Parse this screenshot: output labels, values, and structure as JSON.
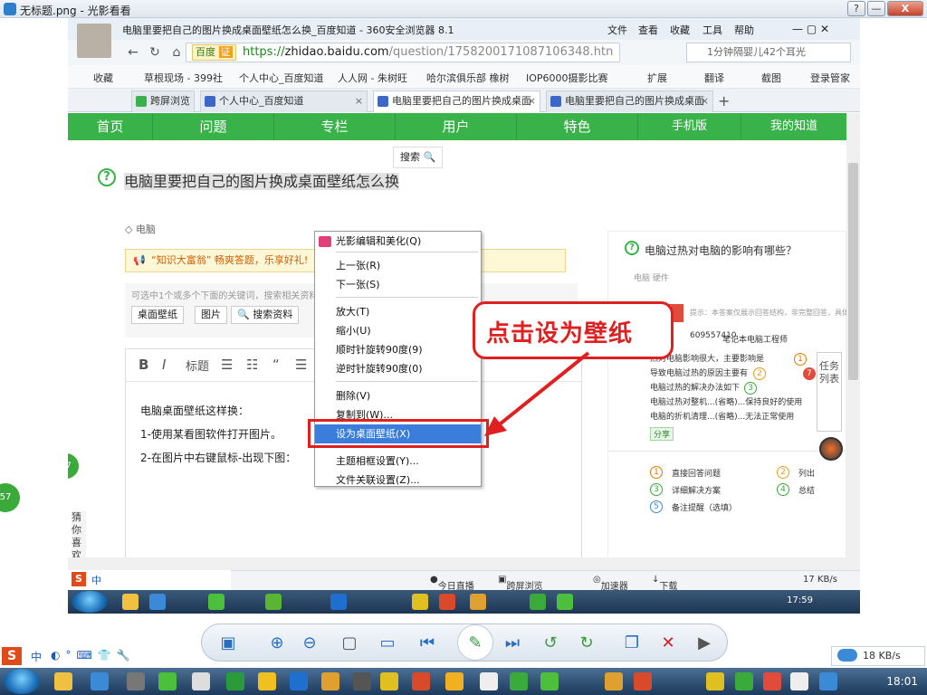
{
  "viewer": {
    "title": "无标题.png - 光影看看",
    "controls": {
      "help": "?",
      "minimize": "—",
      "restore": "□",
      "close": "X"
    },
    "speed": "18 KB/s",
    "clock": "18:01",
    "ime": "中"
  },
  "browser": {
    "title": "电脑里要把自己的图片换成桌面壁纸怎么换_百度知道 - 360安全浏览器 8.1",
    "menu": [
      "文件",
      "查看",
      "收藏",
      "工具",
      "帮助"
    ],
    "baidu_tag": "百度",
    "baidu_tag_cert": "证",
    "url_https": "https://",
    "url_domain": "zhidao.baidu.com",
    "url_rest": "/question/175820017108710634‌8.htn",
    "search_text": "1分钟隔婴儿42个耳光",
    "favorites": [
      "收藏",
      "草根现场 - 399社",
      "个人中心_百度知道",
      "人人网 - 朱树旺",
      "哈尔滨俱乐部 橡树",
      "IOP6000摄影比赛",
      "扩展",
      "翻译",
      "截图",
      "登录管家"
    ],
    "tabs": [
      {
        "label": "跨屏浏览",
        "active": false
      },
      {
        "label": "个人中心_百度知道",
        "active": false
      },
      {
        "label": "电脑里要把自己的图片换成桌面",
        "active": true
      },
      {
        "label": "电脑里要把自己的图片换成桌面",
        "active": false
      }
    ],
    "status": [
      "今日直播",
      "跨屏浏览",
      "加速器",
      "下载",
      "17 KB/s"
    ],
    "inner_clock": "17:59"
  },
  "page": {
    "nav": [
      "首页",
      "问题",
      "专栏",
      "用户",
      "特色",
      "手机版",
      "我的知道"
    ],
    "search_mini": "搜索",
    "question_title": "电脑里要把自己的图片换成桌面壁纸怎么换",
    "tag": "电脑",
    "promo_prefix": "“知识大富翁” 畅爽答题，乐享好礼!",
    "hint": "可选中1个或多个下面的关键词，搜索相关资料。也可直接点“搜索资料”搜索整个问题。",
    "keywords": [
      "桌面壁纸",
      "图片",
      "搜索资料"
    ],
    "toolbar": {
      "bold": "B",
      "italic": "I",
      "heading": "标题",
      "quote": "“"
    },
    "editor_lines": [
      "电脑桌面壁纸这样换：",
      "1-使用某看图软件打开图片。",
      "2-在图片中右键鼠标-出现下图："
    ]
  },
  "context_menu": {
    "items": [
      {
        "label": "光影编辑和美化(Q)",
        "highlight": false
      },
      {
        "label": "上一张(R)",
        "highlight": false
      },
      {
        "label": "下一张(S)",
        "highlight": false
      },
      {
        "label": "放大(T)",
        "highlight": false
      },
      {
        "label": "缩小(U)",
        "highlight": false
      },
      {
        "label": "顺时针旋转90度(9)",
        "highlight": false
      },
      {
        "label": "逆时针旋转90度(0)",
        "highlight": false
      },
      {
        "label": "删除(V)",
        "highlight": false
      },
      {
        "label": "复制到(W)...",
        "highlight": false
      },
      {
        "label": "设为桌面壁纸(X)",
        "highlight": true
      },
      {
        "label": "主题相框设置(Y)...",
        "highlight": false
      },
      {
        "label": "文件关联设置(Z)...",
        "highlight": false
      }
    ]
  },
  "annotation": {
    "callout": "点击设为壁纸",
    "color": "#e02020"
  },
  "right_panel": {
    "question": "电脑过热对电脑的影响有哪些？",
    "tag": "电脑  硬件",
    "pro_label": "专业回答",
    "pro_hint": "提示：本答案仅展示回答结构，非完整回答，具体",
    "phone": "609557410",
    "author": "笔记本电脑工程师",
    "lines": [
      "热对电脑影响很大，主要影响是",
      "导致电脑过热的原因主要有",
      "电脑过热的解决办法如下",
      "电脑过热对整机...(省略)...保持良好的使用",
      "电脑的折机清理...(省略)...无法正常使用"
    ],
    "share": "分享",
    "tips": [
      "直接回答问题",
      "列出",
      "详细解决方案",
      "总结",
      "备注提醒（选填）"
    ],
    "task_label": "任务列表"
  },
  "guess": "猜你喜欢",
  "float_badge": "57"
}
